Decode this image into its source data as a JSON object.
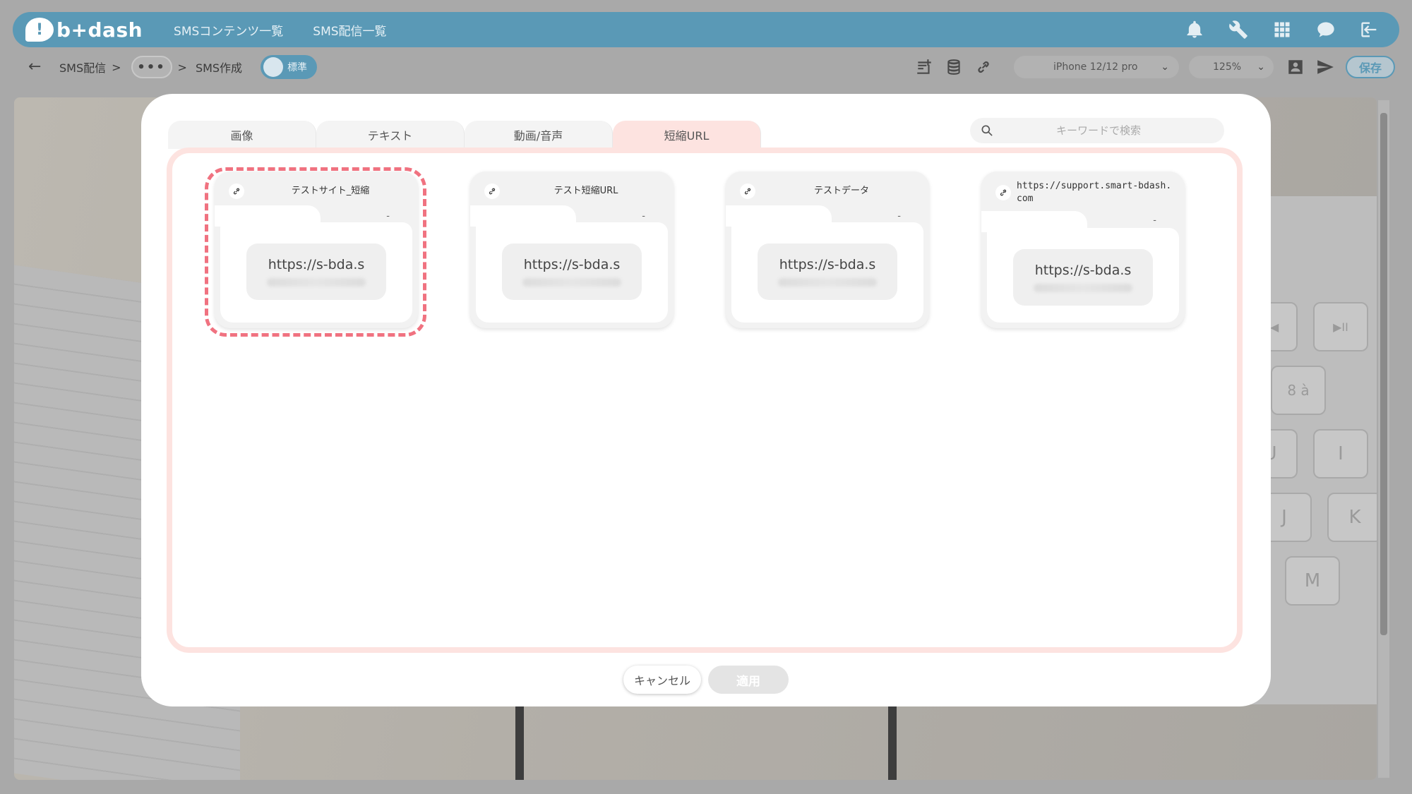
{
  "header": {
    "logo_text": "b+dash",
    "logo_mark": "!",
    "nav": [
      "SMSコンテンツ一覧",
      "SMS配信一覧"
    ],
    "icons": [
      "bell-icon",
      "wrench-icon",
      "apps-grid-icon",
      "chat-icon",
      "logout-icon"
    ]
  },
  "toolbar": {
    "back_icon": "←",
    "breadcrumb_root": "SMS配信",
    "sep": ">",
    "more": "•••",
    "breadcrumb_current": "SMS作成",
    "mode_label": "標準",
    "device": "iPhone 12/12 pro",
    "zoom": "125%",
    "chevron": "⌄",
    "save_label": "保存"
  },
  "canvas": {
    "keys": [
      "◀◀",
      "▶II",
      "8 à",
      "U",
      "I",
      "J",
      "K",
      "M"
    ]
  },
  "modal": {
    "tabs": [
      "画像",
      "テキスト",
      "動画/音声",
      "短縮URL"
    ],
    "active_tab": "短縮URL",
    "search_placeholder": "キーワードで検索",
    "cards": [
      {
        "title": "テストサイト_短縮",
        "dash": "-",
        "url": "https://s-bda.s",
        "selected": true
      },
      {
        "title": "テスト短縮URL",
        "dash": "-",
        "url": "https://s-bda.s",
        "selected": false
      },
      {
        "title": "テストデータ",
        "dash": "-",
        "url": "https://s-bda.s",
        "selected": false
      },
      {
        "title": "https://support.smart-bdash.com",
        "dash": "-",
        "url": "https://s-bda.s",
        "selected": false
      }
    ],
    "cancel_label": "キャンセル",
    "apply_label": "適用"
  },
  "colors": {
    "header_bg": "#5a99b6",
    "active_tab_bg": "#fde3e0",
    "selection_ring": "#f07280"
  }
}
